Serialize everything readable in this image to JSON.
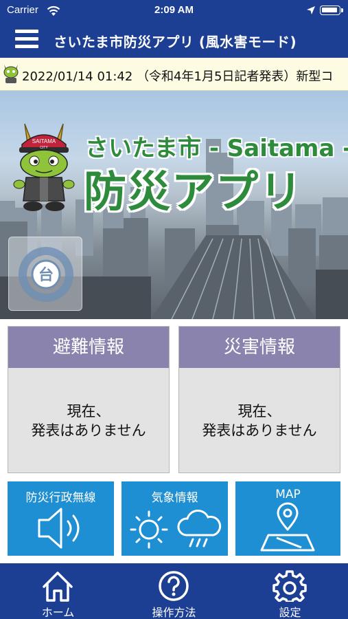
{
  "status_bar": {
    "carrier": "Carrier",
    "time": "2:09 AM"
  },
  "header": {
    "title": "さいたま市防災アプリ (風水害モード)"
  },
  "ticker": {
    "text": "2022/01/14 01:42 （令和4年1月5日記者発表）新型コ"
  },
  "hero": {
    "title_line1": "さいたま市 - Saitama -",
    "title_line2": "防災アプリ",
    "mascot_cap_text": "SAITAMA",
    "mascot_cap_subtext": "CITY",
    "typhoon_icon_text": "台"
  },
  "panels": [
    {
      "title": "避難情報",
      "body_line1": "現在、",
      "body_line2": "発表はありません"
    },
    {
      "title": "災害情報",
      "body_line1": "現在、",
      "body_line2": "発表はありません"
    }
  ],
  "tiles": [
    {
      "label": "防災行政無線",
      "icon": "speaker-icon"
    },
    {
      "label": "気象情報",
      "icon": "weather-icon"
    },
    {
      "label": "MAP",
      "icon": "map-pin-icon"
    }
  ],
  "tabbar": {
    "home_label": "ホーム",
    "help_label": "操作方法",
    "settings_label": "設定"
  },
  "colors": {
    "header_bg": "#1c3f94",
    "ticker_bg": "#fdfbe2",
    "panel_head": "#8a83ad",
    "tile_bg": "#1f8fd3",
    "title_green": "#2f8b3c"
  }
}
